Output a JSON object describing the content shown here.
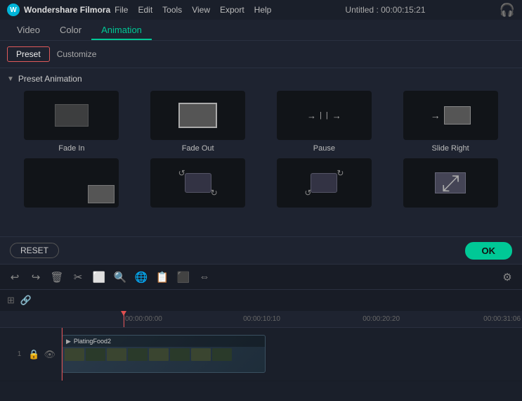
{
  "titleBar": {
    "appName": "Wondershare Filmora",
    "menuItems": [
      "File",
      "Edit",
      "Tools",
      "View",
      "Export",
      "Help"
    ],
    "title": "Untitled : 00:00:15:21",
    "headphoneIcon": "🎧"
  },
  "tabs": {
    "items": [
      "Video",
      "Color",
      "Animation"
    ],
    "active": "Animation"
  },
  "subTabs": {
    "preset": "Preset",
    "customize": "Customize"
  },
  "animSection": {
    "header": "Preset Animation",
    "presets": [
      {
        "id": "fade-in",
        "label": "Fade In"
      },
      {
        "id": "fade-out",
        "label": "Fade Out"
      },
      {
        "id": "pause",
        "label": "Pause"
      },
      {
        "id": "slide-right",
        "label": "Slide Right"
      },
      {
        "id": "row2-1",
        "label": ""
      },
      {
        "id": "row2-2",
        "label": ""
      },
      {
        "id": "row2-3",
        "label": ""
      },
      {
        "id": "row2-4",
        "label": ""
      }
    ]
  },
  "buttons": {
    "reset": "RESET",
    "ok": "OK"
  },
  "toolbar": {
    "icons": [
      "↩",
      "↪",
      "🗑",
      "✂",
      "⬜",
      "🔍",
      "🌐",
      "📋",
      "⬛",
      "⇔"
    ],
    "settingsIcon": "⚙"
  },
  "timeline": {
    "markers": [
      "00:00:00:00",
      "00:00:10:10",
      "00:00:20:20",
      "00:00:31:06"
    ],
    "clipName": "PlatingFood2",
    "layerNum": "1"
  }
}
